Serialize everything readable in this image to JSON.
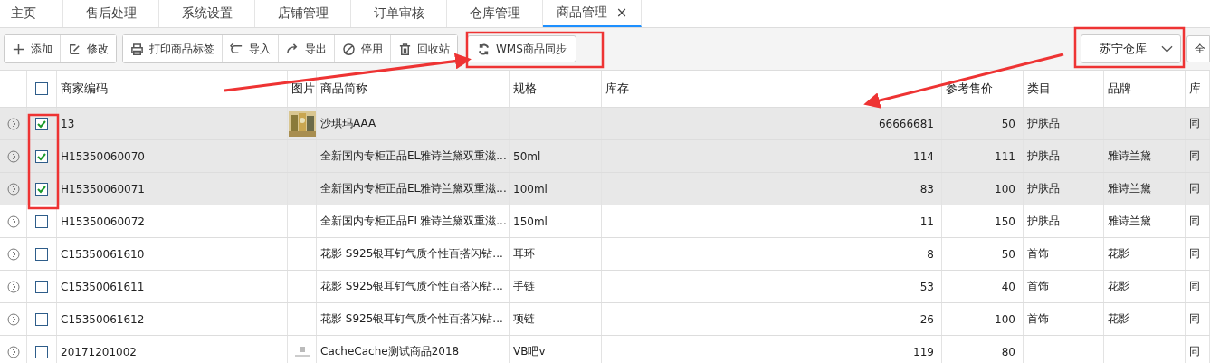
{
  "tabs": [
    {
      "label": "主页",
      "selected": false
    },
    {
      "label": "售后处理",
      "selected": false
    },
    {
      "label": "系统设置",
      "selected": false
    },
    {
      "label": "店铺管理",
      "selected": false
    },
    {
      "label": "订单审核",
      "selected": false
    },
    {
      "label": "仓库管理",
      "selected": false
    },
    {
      "label": "商品管理",
      "selected": true,
      "close": "×"
    }
  ],
  "toolbar": {
    "groups": [
      [
        "添加",
        "修改"
      ],
      [
        "打印商品标签",
        "导入",
        "导出",
        "停用",
        "回收站"
      ]
    ],
    "sync_button": "WMS商品同步",
    "warehouse_select": "苏宁仓库",
    "column_9": "全"
  },
  "table": {
    "all_checked": false,
    "columns": [
      "商家编码",
      "图片",
      "商品简称",
      "规格",
      "库存",
      "参考售价",
      "类目",
      "品牌",
      "库"
    ],
    "rows": [
      {
        "kind": "picture",
        "selected": true,
        "code": "13",
        "name": "沙琪玛AAA",
        "spec": "",
        "stock": "66666681",
        "price": "50",
        "category": "护肤品",
        "brand": "",
        "column_9": "同"
      },
      {
        "kind": "plain",
        "selected": true,
        "code": "H15350060070",
        "name": "全新国内专柜正品EL雅诗兰黛双重滋...",
        "spec": "50ml",
        "stock": "114",
        "price": "111",
        "category": "护肤品",
        "brand": "雅诗兰黛",
        "column_9": "同"
      },
      {
        "kind": "plain",
        "selected": true,
        "code": "H15350060071",
        "name": "全新国内专柜正品EL雅诗兰黛双重滋...",
        "spec": "100ml",
        "stock": "83",
        "price": "100",
        "category": "护肤品",
        "brand": "雅诗兰黛",
        "column_9": "同"
      },
      {
        "kind": "plain",
        "selected": false,
        "code": "H15350060072",
        "name": "全新国内专柜正品EL雅诗兰黛双重滋...",
        "spec": "150ml",
        "stock": "11",
        "price": "150",
        "category": "护肤品",
        "brand": "雅诗兰黛",
        "column_9": "同"
      },
      {
        "kind": "plain",
        "selected": false,
        "code": "C15350061610",
        "name": "花影 S925银耳钉气质个性百搭闪钻...",
        "spec": "耳环",
        "stock": "8",
        "price": "50",
        "category": "首饰",
        "brand": "花影",
        "column_9": "同"
      },
      {
        "kind": "plain",
        "selected": false,
        "code": "C15350061611",
        "name": "花影 S925银耳钉气质个性百搭闪钻...",
        "spec": "手链",
        "stock": "53",
        "price": "40",
        "category": "首饰",
        "brand": "花影",
        "column_9": "同"
      },
      {
        "kind": "plain",
        "selected": false,
        "code": "C15350061612",
        "name": "花影 S925银耳钉气质个性百搭闪钻...",
        "spec": "项链",
        "stock": "26",
        "price": "100",
        "category": "首饰",
        "brand": "花影",
        "column_9": "同"
      },
      {
        "kind": "placeholder",
        "selected": false,
        "code": "20171201002",
        "name": "CacheCache测试商品2018",
        "spec": "VB吧v",
        "stock": "119",
        "price": "80",
        "category": "",
        "brand": "",
        "column_9": "同"
      }
    ]
  }
}
